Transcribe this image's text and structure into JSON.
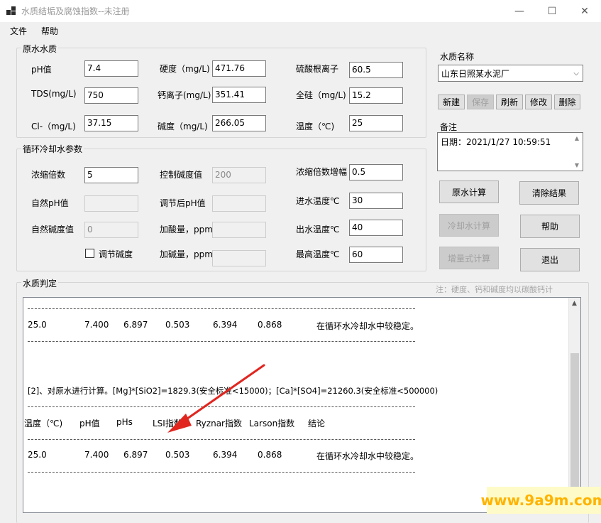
{
  "window": {
    "title": "水质结垢及腐蚀指数--未注册",
    "controls": {
      "minimize": "—",
      "maximize": "☐",
      "close": "✕"
    }
  },
  "menu": {
    "file": "文件",
    "help": "帮助"
  },
  "raw_water": {
    "group_title": "原水水质",
    "ph_label": "pH值",
    "ph_value": "7.4",
    "hardness_label": "硬度（mg/L)",
    "hardness_value": "471.76",
    "sulfate_label": "硫酸根离子",
    "sulfate_value": "60.5",
    "tds_label": "TDS(mg/L)",
    "tds_value": "750",
    "calcium_label": "钙离子(mg/L)",
    "calcium_value": "351.41",
    "silica_label": "全硅（mg/L)",
    "silica_value": "15.2",
    "chloride_label": "Cl-（mg/L)",
    "chloride_value": "37.15",
    "alkalinity_label": "碱度（mg/L)",
    "alkalinity_value": "266.05",
    "temperature_label": "温度（℃)",
    "temperature_value": "25"
  },
  "circulating": {
    "group_title": "循环冷却水参数",
    "concentration_label": "浓缩倍数",
    "concentration_value": "5",
    "control_alk_label": "控制碱度值",
    "control_alk_value": "200",
    "conc_increase_label": "浓缩倍数增幅",
    "conc_increase_value": "0.5",
    "natural_ph_label": "自然pH值",
    "natural_ph_value": "",
    "adjusted_ph_label": "调节后pH值",
    "adjusted_ph_value": "",
    "inlet_temp_label": "进水温度℃",
    "inlet_temp_value": "30",
    "natural_alk_label": "自然碱度值",
    "natural_alk_value": "0",
    "acid_label": "加酸量，ppm",
    "acid_value": "",
    "outlet_temp_label": "出水温度℃",
    "outlet_temp_value": "40",
    "adjust_alk_label": "调节碱度",
    "base_label": "加碱量，ppm",
    "base_value": "",
    "max_temp_label": "最高温度℃",
    "max_temp_value": "60"
  },
  "side": {
    "quality_name_label": "水质名称",
    "quality_name_value": "山东日照某水泥厂",
    "buttons": {
      "new": "新建",
      "save": "保存",
      "refresh": "刷新",
      "modify": "修改",
      "delete": "删除"
    },
    "remark_label": "备注",
    "remark_value": "日期：2021/1/27 10:59:51",
    "raw_calc": "原水计算",
    "clear": "清除结果",
    "cooling_calc": "冷却水计算",
    "help": "帮助",
    "incremental_calc": "增量式计算",
    "exit": "退出"
  },
  "judgement": {
    "group_title": "水质判定",
    "note": "注：硬度、钙和碱度均以碳酸钙计",
    "row1": [
      "25.0",
      "7.400",
      "6.897",
      "0.503",
      "6.394",
      "0.868",
      "在循环水冷却水中较稳定。"
    ],
    "calc_line": "[2]、对原水进行计算。[Mg]*[SiO2]=1829.3(安全标准<15000)；[Ca]*[SO4]=21260.3(安全标准<500000)",
    "headers": [
      "温度（℃)",
      "pH值",
      "pHs",
      "LSI指数",
      "Ryznar指数",
      "Larson指数",
      "结论"
    ],
    "row2": [
      "25.0",
      "7.400",
      "6.897",
      "0.503",
      "6.394",
      "0.868",
      "在循环水冷却水中较稳定。"
    ]
  },
  "watermark": "www.9a9m.com",
  "colors": {
    "arrow": "#e0261f",
    "watermark_text": "#ffb300",
    "accent": "#0078d7"
  }
}
